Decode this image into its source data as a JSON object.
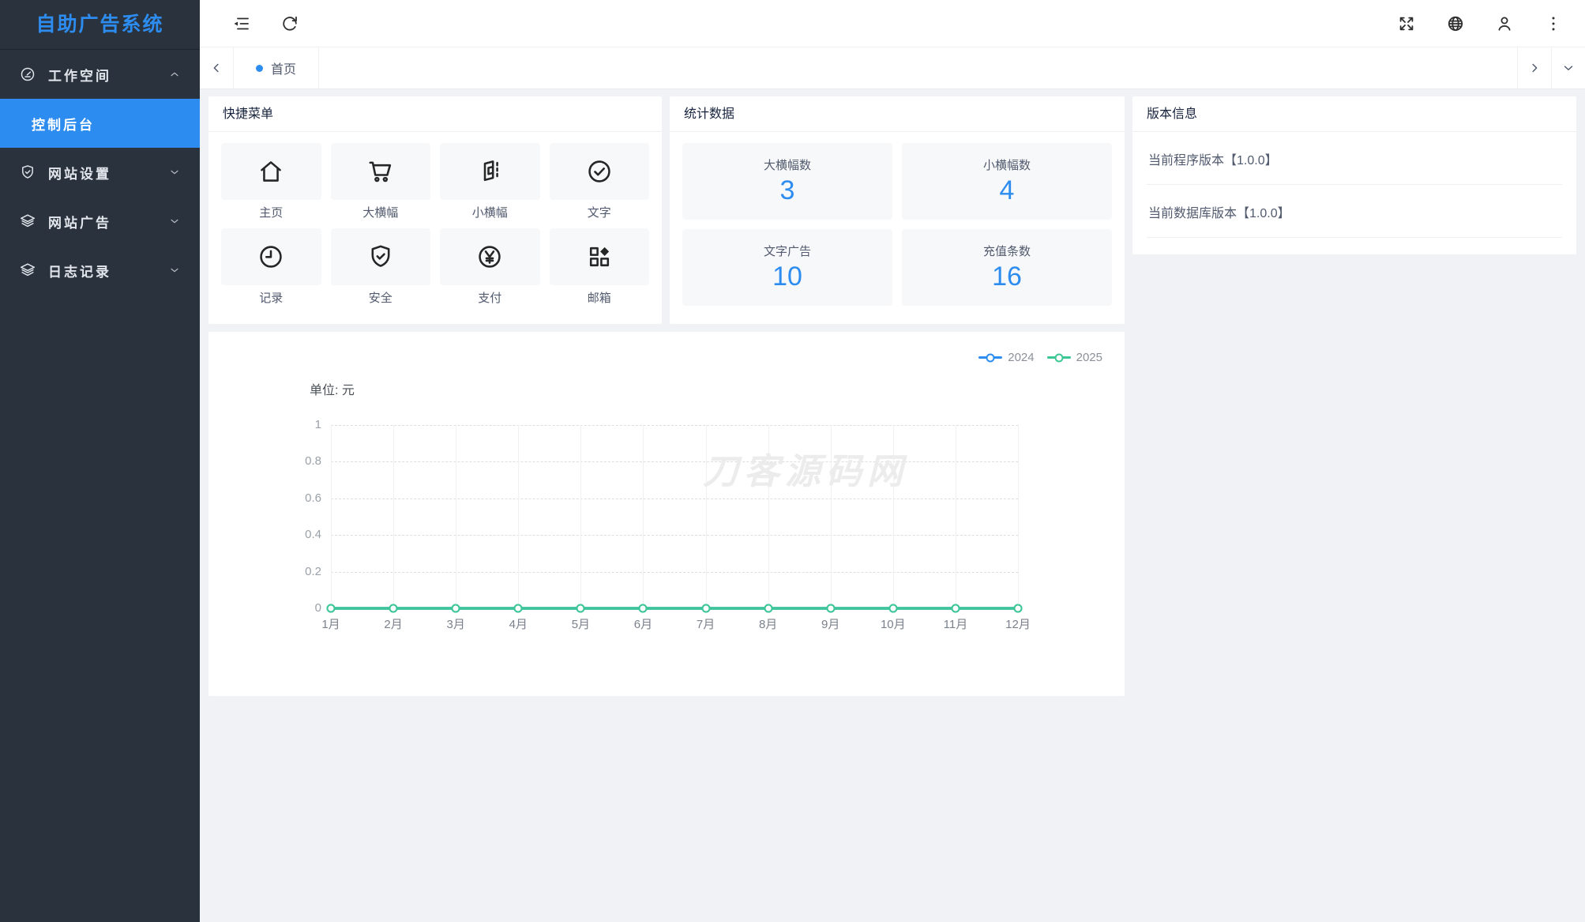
{
  "app": {
    "name": "自助广告系统"
  },
  "sidebar": {
    "logo": "自助广告系统",
    "items": [
      {
        "label": "工作空间",
        "icon": "gauge-icon",
        "state": "expanded"
      },
      {
        "label": "控制后台",
        "active": true
      },
      {
        "label": "网站设置",
        "icon": "shield-check-icon",
        "state": "collapsed"
      },
      {
        "label": "网站广告",
        "icon": "layers-icon",
        "state": "collapsed"
      },
      {
        "label": "日志记录",
        "icon": "layers-icon",
        "state": "collapsed"
      }
    ]
  },
  "tabbar": {
    "tabs": [
      {
        "label": "首页",
        "active": true
      }
    ]
  },
  "quick_menu": {
    "title": "快捷菜单",
    "items": [
      {
        "label": "主页",
        "icon": "home-icon"
      },
      {
        "label": "大横幅",
        "icon": "cart-icon"
      },
      {
        "label": "小横幅",
        "icon": "banner-icon"
      },
      {
        "label": "文字",
        "icon": "check-circle-icon"
      },
      {
        "label": "记录",
        "icon": "clock-icon"
      },
      {
        "label": "安全",
        "icon": "shield-icon"
      },
      {
        "label": "支付",
        "icon": "yen-circle-icon"
      },
      {
        "label": "邮箱",
        "icon": "components-icon"
      }
    ]
  },
  "stats": {
    "title": "统计数据",
    "items": [
      {
        "label": "大横幅数",
        "value": "3"
      },
      {
        "label": "小横幅数",
        "value": "4"
      },
      {
        "label": "文字广告",
        "value": "10"
      },
      {
        "label": "充值条数",
        "value": "16"
      }
    ]
  },
  "version": {
    "title": "版本信息",
    "rows": [
      {
        "text": "当前程序版本【1.0.0】"
      },
      {
        "text": "当前数据库版本【1.0.0】"
      }
    ]
  },
  "chart_data": {
    "type": "line",
    "unit_label": "单位: 元",
    "categories": [
      "1月",
      "2月",
      "3月",
      "4月",
      "5月",
      "6月",
      "7月",
      "8月",
      "9月",
      "10月",
      "11月",
      "12月"
    ],
    "series": [
      {
        "name": "2024",
        "color": "#2d8cf0",
        "values": [
          0,
          0,
          0,
          0,
          0,
          0,
          0,
          0,
          0,
          0,
          0,
          0
        ]
      },
      {
        "name": "2025",
        "color": "#3cc794",
        "values": [
          0,
          0,
          0,
          0,
          0,
          0,
          0,
          0,
          0,
          0,
          0,
          0
        ]
      }
    ],
    "ylim": [
      0,
      1
    ],
    "yticks": [
      0,
      0.2,
      0.4,
      0.6,
      0.8,
      1
    ],
    "legend_position": "top-right",
    "grid": true,
    "watermark": "刀客源码网"
  },
  "colors": {
    "primary": "#2d8cf0",
    "series_green": "#3cc794",
    "sidebar_bg": "#2a333d"
  }
}
